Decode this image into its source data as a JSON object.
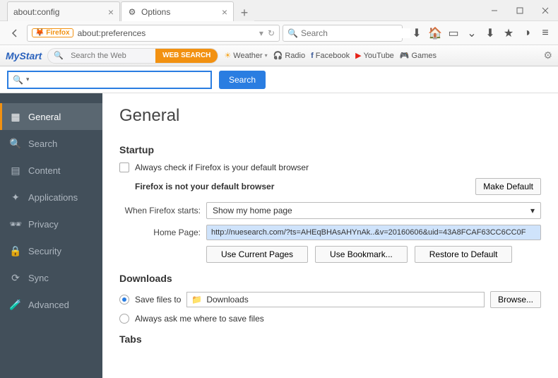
{
  "tabs": [
    {
      "label": "about:config",
      "active": false
    },
    {
      "label": "Options",
      "active": true
    }
  ],
  "urlbar": {
    "badge": "Firefox",
    "value": "about:preferences"
  },
  "searchbox": {
    "placeholder": "Search"
  },
  "mystart": {
    "logo": "MyStart",
    "search_placeholder": "Search the Web",
    "search_button": "WEB SEARCH",
    "links": [
      "Weather",
      "Radio",
      "Facebook",
      "YouTube",
      "Games"
    ]
  },
  "searchbar2": {
    "button": "Search"
  },
  "sidebar": {
    "items": [
      {
        "label": "General"
      },
      {
        "label": "Search"
      },
      {
        "label": "Content"
      },
      {
        "label": "Applications"
      },
      {
        "label": "Privacy"
      },
      {
        "label": "Security"
      },
      {
        "label": "Sync"
      },
      {
        "label": "Advanced"
      }
    ]
  },
  "prefs": {
    "title": "General",
    "startup": {
      "heading": "Startup",
      "check_default": "Always check if Firefox is your default browser",
      "not_default": "Firefox is not your default browser",
      "make_default": "Make Default",
      "when_starts_label": "When Firefox starts:",
      "when_starts_value": "Show my home page",
      "homepage_label": "Home Page:",
      "homepage_value": "http://nuesearch.com/?ts=AHEqBHAsAHYnAk..&v=20160606&uid=43A8FCAF63CC6CC0F",
      "use_current": "Use Current Pages",
      "use_bookmark": "Use Bookmark...",
      "restore_default": "Restore to Default"
    },
    "downloads": {
      "heading": "Downloads",
      "save_to": "Save files to",
      "folder": "Downloads",
      "browse": "Browse...",
      "always_ask": "Always ask me where to save files"
    },
    "tabs": {
      "heading": "Tabs"
    }
  }
}
